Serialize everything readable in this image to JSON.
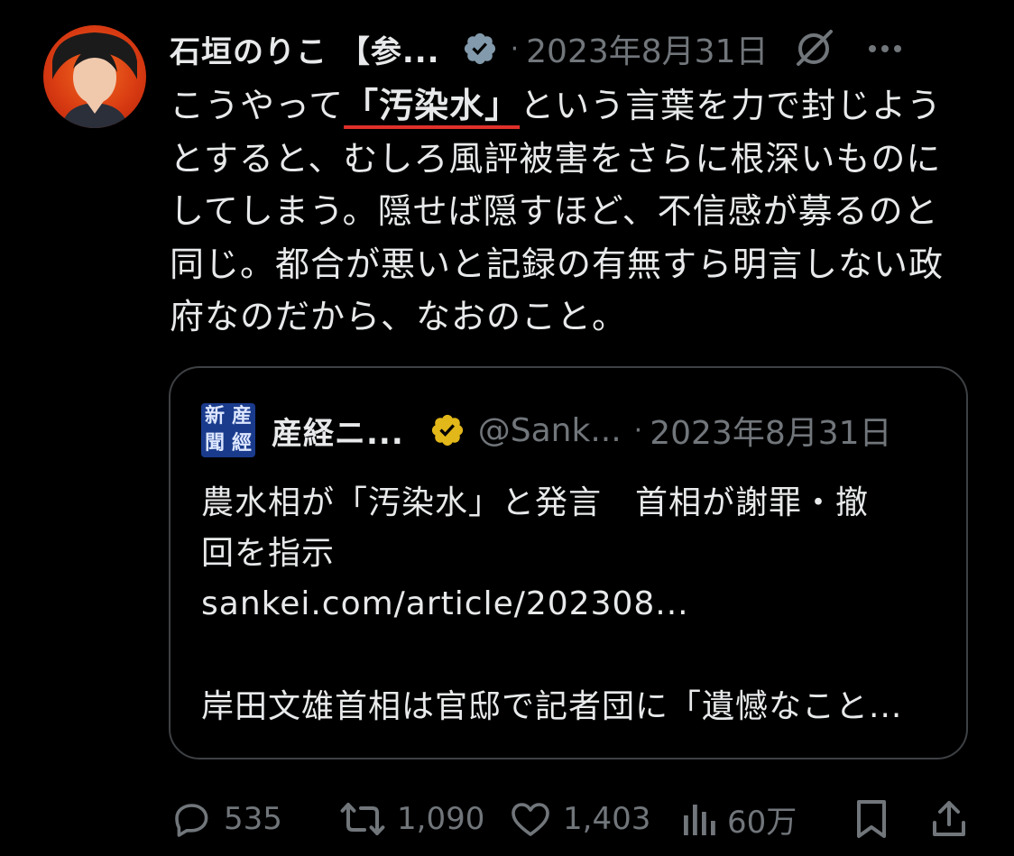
{
  "post": {
    "author_name": "石垣のりこ 【参...",
    "dot": "·",
    "date": "2023年8月31日",
    "text_before": "こうやって",
    "text_highlight": "「汚染水」",
    "text_after": "という言葉を力で封じようとすると、むしろ風評被害をさらに根深いものにしてしまう。隠せば隠すほど、不信感が募るのと同じ。都合が悪いと記録の有無すら明言しない政府なのだから、なおのこと。",
    "icons": [
      "verified-badge-icon",
      "grok-icon",
      "more-icon"
    ]
  },
  "quote": {
    "logo_chars": [
      "産",
      "經",
      "新",
      "聞"
    ],
    "author_name": "産経ニ...",
    "handle": "@Sank...",
    "dot": "·",
    "date": "2023年8月31日",
    "line1": "農水相が「汚染水」と発言　首相が謝罪・撤",
    "line2": "回を指示",
    "line3": "sankei.com/article/202308...",
    "line4": "岸田文雄首相は官邸で記者団に「遺憾なこと..."
  },
  "actions": {
    "replies": "535",
    "reposts": "1,090",
    "likes": "1,403",
    "views": "60万"
  },
  "colors": {
    "background": "#000000",
    "text": "#e7e9ea",
    "muted": "#71767b",
    "verified_gray": "#829aab",
    "verified_gold": "#e2b719",
    "underline_red": "#e0302a",
    "quote_border": "#3e4144"
  }
}
